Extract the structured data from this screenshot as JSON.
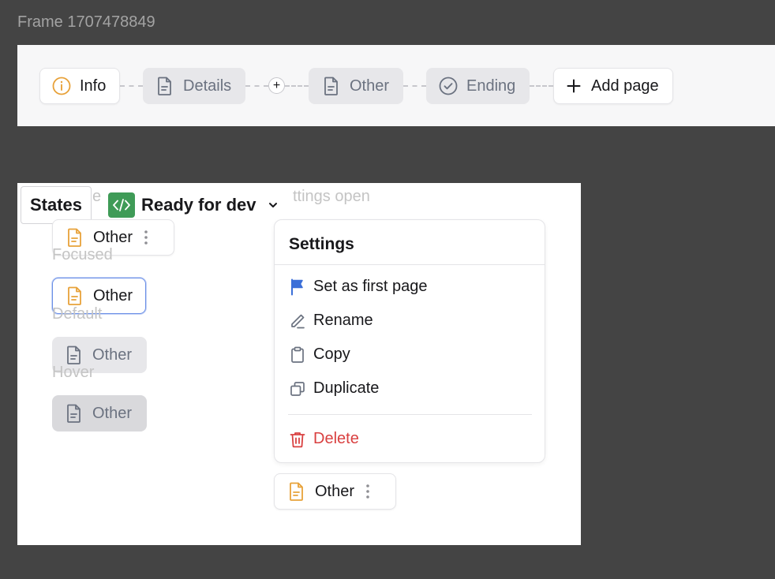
{
  "frame": {
    "title": "Frame 1707478849"
  },
  "steps": {
    "info": {
      "label": "Info",
      "icon": "info-circle-icon"
    },
    "details": {
      "label": "Details",
      "icon": "document-icon"
    },
    "other": {
      "label": "Other",
      "icon": "document-icon"
    },
    "ending": {
      "label": "Ending",
      "icon": "check-circle-icon"
    },
    "add_page": {
      "label": "Add page",
      "icon": "plus-icon"
    },
    "insert_symbol": "+"
  },
  "toolbar": {
    "states_label": "States",
    "status_label": "Ready for dev",
    "status_icon": "code-icon",
    "status_color": "#3f9b57"
  },
  "states": {
    "partial_label_left": "e",
    "partial_label_right": "ttings open",
    "focused_label": "Focused",
    "default_label": "Default",
    "hover_label": "Hover",
    "chip_label": "Other",
    "chip_icon_color": "#e8a23a"
  },
  "menu": {
    "title": "Settings",
    "items": [
      {
        "label": "Set as first page",
        "icon": "flag-icon",
        "color": "#3b6fd8"
      },
      {
        "label": "Rename",
        "icon": "pencil-icon"
      },
      {
        "label": "Copy",
        "icon": "clipboard-icon"
      },
      {
        "label": "Duplicate",
        "icon": "duplicate-icon"
      },
      {
        "label": "Delete",
        "icon": "trash-icon",
        "color": "#d94040"
      }
    ]
  }
}
